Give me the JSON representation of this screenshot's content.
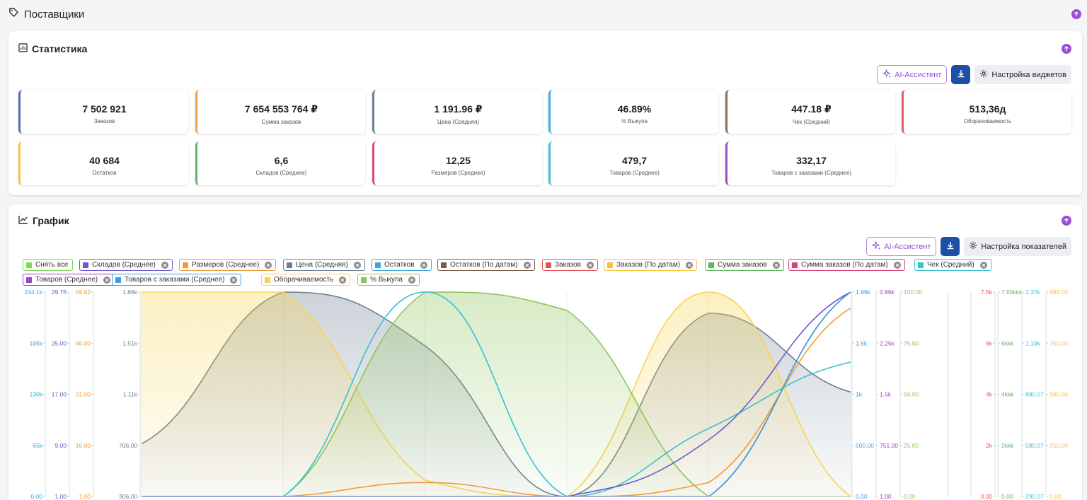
{
  "section": {
    "title": "Поставщики"
  },
  "stats": {
    "title": "Статистика",
    "ai_label": "AI-Ассистент",
    "settings_label": "Настройка виджетов",
    "tiles": [
      {
        "value": "7 502 921",
        "label": "Заказов",
        "color": "#5b6bb8"
      },
      {
        "value": "7 654 553 764 ₽",
        "label": "Сумма заказов",
        "color": "#f0a04a"
      },
      {
        "value": "1 191.96 ₽",
        "label": "Цена (Средняя)",
        "color": "#6c7f93"
      },
      {
        "value": "46.89%",
        "label": "% Выкупа",
        "color": "#3eaee0"
      },
      {
        "value": "447.18 ₽",
        "label": "Чек (Средний)",
        "color": "#8b6e60"
      },
      {
        "value": "513,36д",
        "label": "Оборачиваемость",
        "color": "#e06060"
      },
      {
        "value": "40 684",
        "label": "Остатков",
        "color": "#f2c744"
      },
      {
        "value": "6,6",
        "label": "Складов (Среднее)",
        "color": "#66b26a"
      },
      {
        "value": "12,25",
        "label": "Размеров (Среднее)",
        "color": "#d84a7a"
      },
      {
        "value": "479,7",
        "label": "Товаров (Среднее)",
        "color": "#40c0d0"
      },
      {
        "value": "332,17",
        "label": "Товаров с заказами (Среднее)",
        "color": "#a04cc8"
      }
    ]
  },
  "chart": {
    "title": "График",
    "ai_label": "AI-Ассистент",
    "settings_label": "Настройка показателей",
    "chips": [
      {
        "label": "Снять все",
        "color": "#7ed957",
        "closable": false
      },
      {
        "label": "Складов (Среднее)",
        "color": "#6a5acd",
        "closable": true
      },
      {
        "label": "Размеров (Среднее)",
        "color": "#f29a3b",
        "closable": true
      },
      {
        "label": "Цена (Средняя)",
        "color": "#6e8093",
        "closable": true
      },
      {
        "label": "Остатков",
        "color": "#3aa8e0",
        "closable": true
      },
      {
        "label": "Остатков (По датам)",
        "color": "#7a5c4c",
        "closable": true
      },
      {
        "label": "Заказов",
        "color": "#e25555",
        "closable": true
      },
      {
        "label": "Заказов (По датам)",
        "color": "#f5c342",
        "closable": true
      },
      {
        "label": "Сумма заказов",
        "color": "#5cb85c",
        "closable": true
      },
      {
        "label": "Сумма заказов (По датам)",
        "color": "#d6437a",
        "closable": true
      },
      {
        "label": "Чек (Средний)",
        "color": "#38c1cf",
        "closable": true
      },
      {
        "label": "Товаров (Среднее)",
        "color": "#9b45c4",
        "closable": true
      },
      {
        "label": "Товаров с заказами (Среднее)",
        "color": "#3a9fe0",
        "closable": true
      },
      {
        "label": "Оборачиваемость",
        "color": "#f7d451",
        "closable": true
      },
      {
        "label": "% Выкупа",
        "color": "#8fc45a",
        "closable": true
      }
    ]
  },
  "chart_data": {
    "type": "area",
    "grid": true,
    "axes": [
      {
        "color": "#3aa8e0",
        "ticks": [
          "244.1k",
          "195k",
          "130k",
          "65k",
          "0.00"
        ]
      },
      {
        "color": "#6a5acd",
        "ticks": [
          "29.76",
          "25.00",
          "17.00",
          "9.00",
          "1.00"
        ]
      },
      {
        "color": "#f29a3b",
        "ticks": [
          "59.62",
          "46.00",
          "31.00",
          "16.00",
          "1.00"
        ]
      },
      {
        "color": "#6e8093",
        "ticks": [
          "1.86k",
          "1.51k",
          "1.11k",
          "706.00",
          "306.00"
        ]
      },
      {
        "color": "#3a9fe0",
        "ticks": [
          "1.99k",
          "1.5k",
          "1k",
          "500.00",
          "0.00"
        ]
      },
      {
        "color": "#9b45c4",
        "ticks": [
          "2.86k",
          "2.25k",
          "1.5k",
          "751.00",
          "1.00"
        ]
      },
      {
        "color": "#8fc45a",
        "ticks": [
          "100.00",
          "75.00",
          "50.00",
          "25.00",
          "0.00"
        ]
      },
      {
        "color": "#e25555",
        "ticks": [
          "7.5k",
          "6k",
          "4k",
          "2k",
          "0.00"
        ]
      },
      {
        "color": "#5cb85c",
        "ticks": [
          "7.65kkk",
          "6kkk",
          "4kkk",
          "2kkk",
          "0.00"
        ]
      },
      {
        "color": "#38c1cf",
        "ticks": [
          "1.37k",
          "1.19k",
          "890.07",
          "590.07",
          "290.07"
        ]
      },
      {
        "color": "#f5c342",
        "ticks": [
          "999.00",
          "750.00",
          "500.00",
          "250.00",
          "0.00"
        ]
      }
    ],
    "series": [
      {
        "name": "Цена (Средняя)",
        "color": "#6e8093",
        "fill": true,
        "values": [
          706,
          1860,
          1450,
          306,
          1700,
          1100
        ]
      },
      {
        "name": "Оборачиваемость",
        "color": "#f7d451",
        "fill": true,
        "values": [
          999,
          999,
          80,
          0,
          999,
          0
        ]
      },
      {
        "name": "% Выкупа",
        "color": "#8fc45a",
        "fill": true,
        "values": [
          0,
          0,
          100,
          91,
          0,
          0
        ]
      },
      {
        "name": "Чек (Средний)",
        "color": "#38c1cf",
        "fill": false,
        "values": [
          290,
          290,
          1370,
          290,
          650,
          1000
        ]
      },
      {
        "name": "Размеров (Среднее)",
        "color": "#f29a3b",
        "fill": false,
        "values": [
          1,
          1,
          5,
          1,
          5,
          55
        ]
      },
      {
        "name": "Складов (Среднее)",
        "color": "#6a5acd",
        "fill": false,
        "values": [
          1,
          1,
          1,
          1,
          9,
          29.76
        ]
      },
      {
        "name": "Товаров (Среднее)",
        "color": "#9b45c4",
        "fill": false,
        "values": [
          1,
          1,
          1,
          1,
          1,
          2860
        ]
      },
      {
        "name": "Товаров с заказами (Среднее)",
        "color": "#3a9fe0",
        "fill": false,
        "values": [
          0,
          0,
          0,
          0,
          0,
          1990
        ]
      }
    ]
  }
}
